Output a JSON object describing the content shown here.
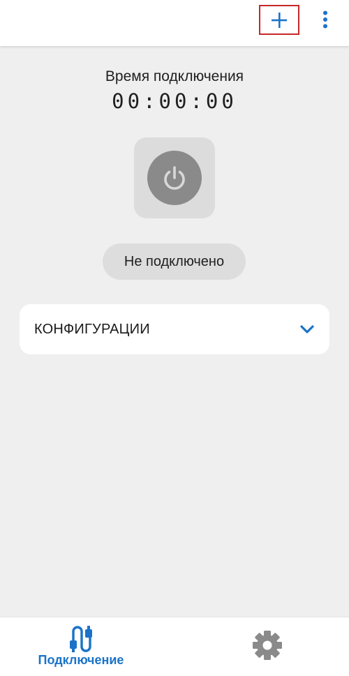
{
  "colors": {
    "accent": "#1a73c8",
    "background": "#efefef",
    "power_button": "#8a8a8a",
    "highlight_box": "#c62828"
  },
  "toolbar": {
    "add_icon": "plus-icon",
    "more_icon": "more-vertical-icon"
  },
  "connection": {
    "timer_label": "Время подключения",
    "timer_value": "00:00:00",
    "power_icon": "power-icon",
    "status": "Не подключено"
  },
  "configurations": {
    "title": "КОНФИГУРАЦИИ",
    "expand_icon": "chevron-down-icon"
  },
  "bottom_nav": {
    "items": [
      {
        "label": "Подключение",
        "icon": "cable-icon",
        "active": true
      },
      {
        "label": "",
        "icon": "gear-icon",
        "active": false
      }
    ]
  }
}
